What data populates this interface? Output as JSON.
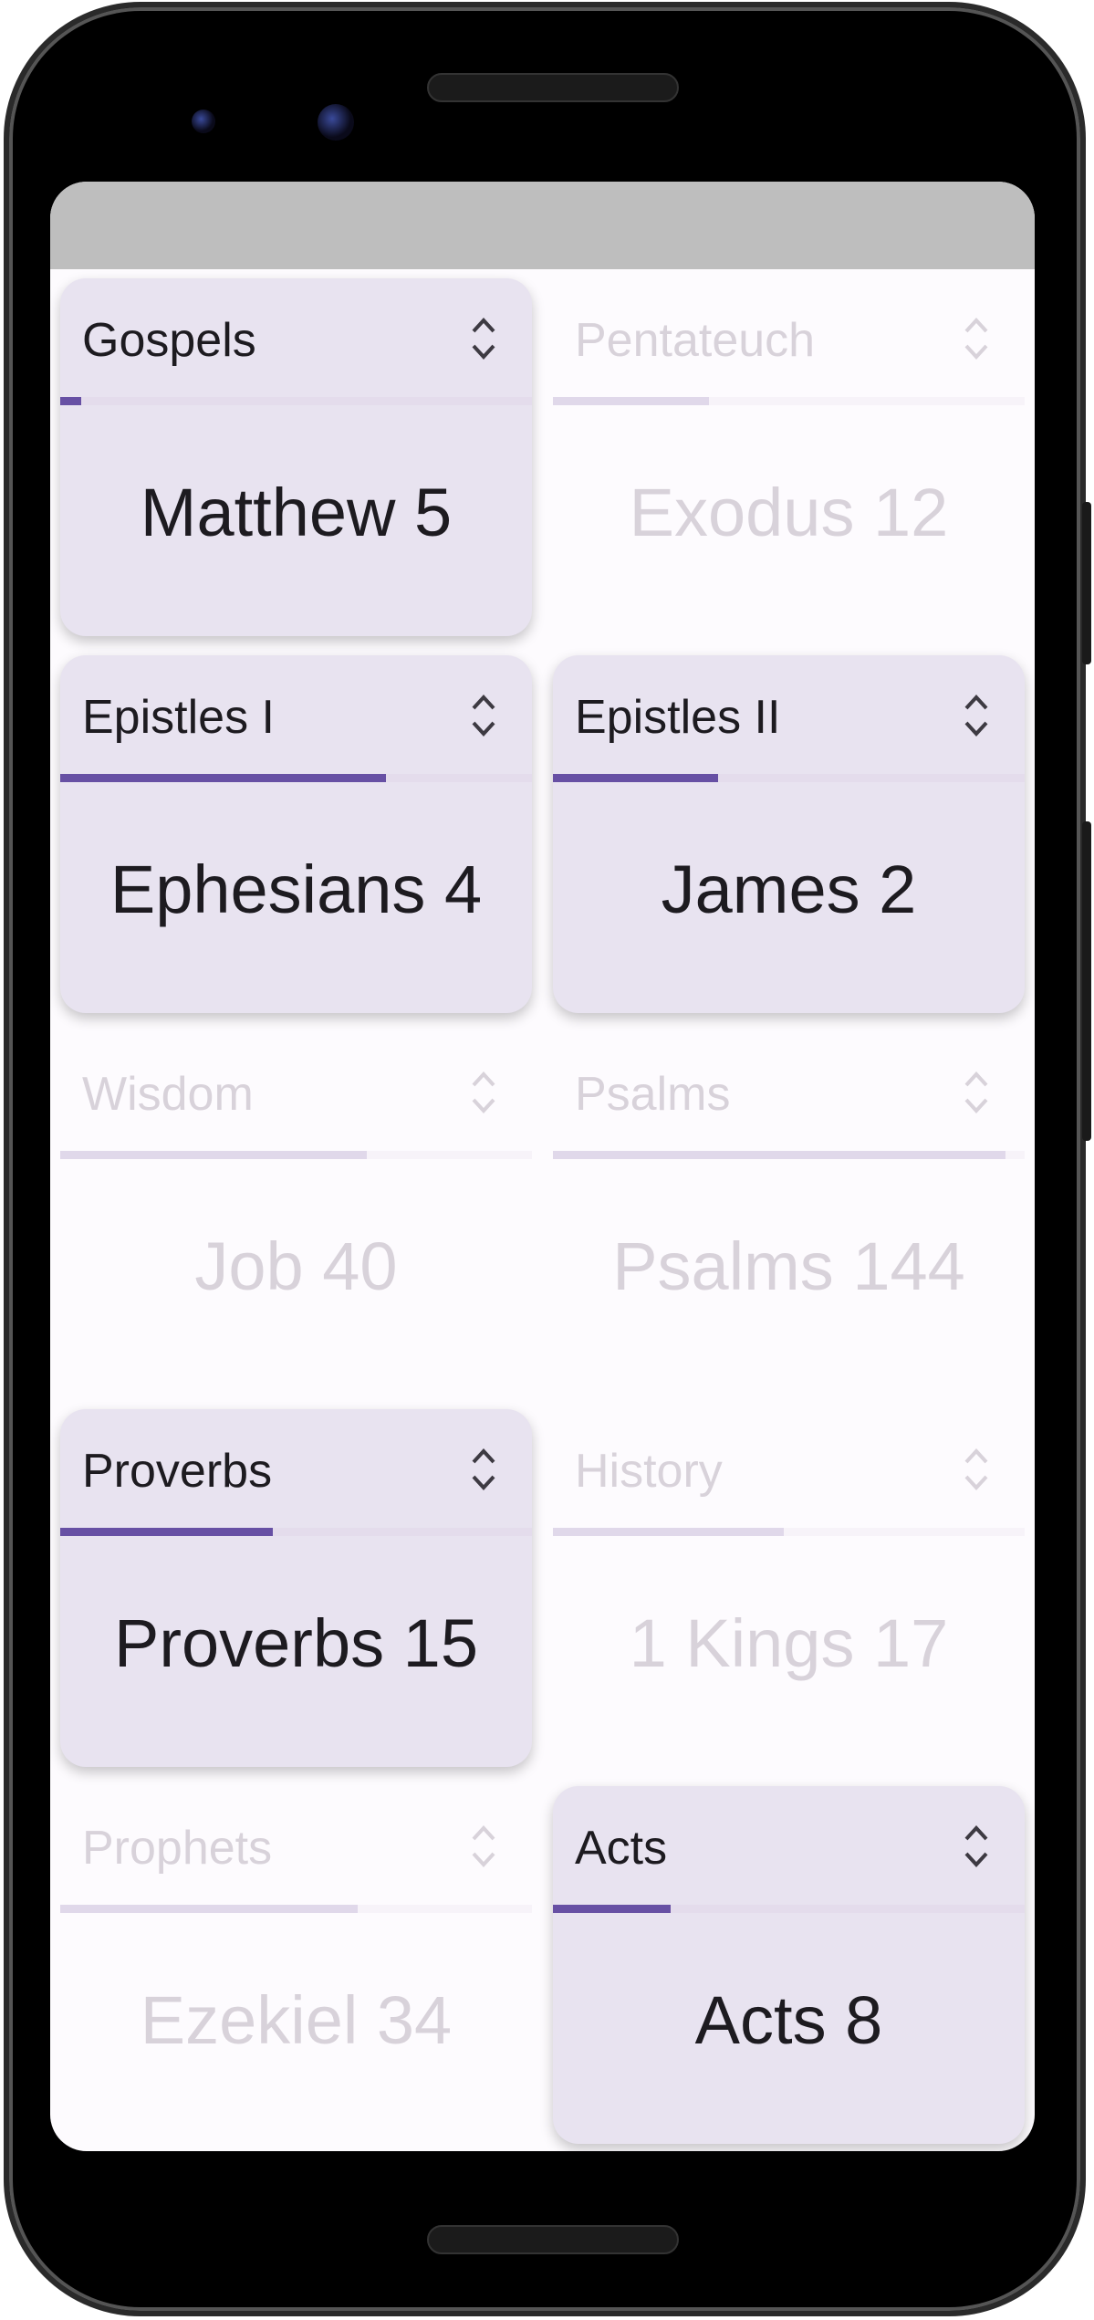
{
  "colors": {
    "accent": "#6750a4",
    "card": "#e8e3f0",
    "inactive_text": "#d8d2da"
  },
  "cards": [
    {
      "category": "Gospels",
      "reading": "Matthew 5",
      "progress": 0.044,
      "active": true
    },
    {
      "category": "Pentateuch",
      "reading": "Exodus 12",
      "progress": 0.33,
      "active": false
    },
    {
      "category": "Epistles I",
      "reading": "Ephesians 4",
      "progress": 0.69,
      "active": true
    },
    {
      "category": "Epistles II",
      "reading": "James 2",
      "progress": 0.35,
      "active": true
    },
    {
      "category": "Wisdom",
      "reading": "Job 40",
      "progress": 0.65,
      "active": false
    },
    {
      "category": "Psalms",
      "reading": "Psalms 144",
      "progress": 0.96,
      "active": false
    },
    {
      "category": "Proverbs",
      "reading": "Proverbs 15",
      "progress": 0.45,
      "active": true
    },
    {
      "category": "History",
      "reading": "1 Kings 17",
      "progress": 0.49,
      "active": false
    },
    {
      "category": "Prophets",
      "reading": "Ezekiel 34",
      "progress": 0.63,
      "active": false
    },
    {
      "category": "Acts",
      "reading": "Acts 8",
      "progress": 0.25,
      "active": true
    }
  ],
  "icons": {
    "toggle": "unfold-more-icon"
  }
}
